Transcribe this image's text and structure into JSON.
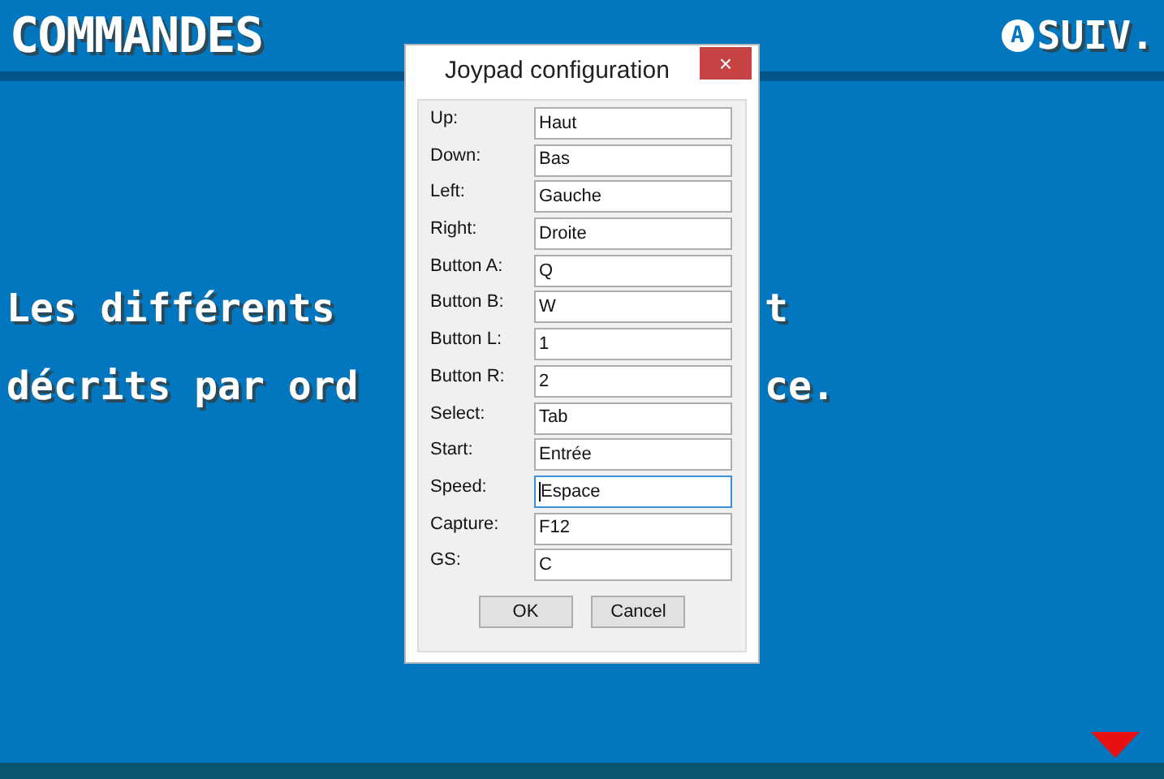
{
  "game_screen": {
    "header_title": "COMMANDES",
    "next_button": {
      "key": "A",
      "label": "SUIV."
    },
    "text_lines": [
      {
        "left": "Les différents",
        "right": "t"
      },
      {
        "left": "décrits par ord",
        "right": "ce."
      }
    ]
  },
  "dialog": {
    "title": "Joypad configuration",
    "close": "×",
    "fields": [
      {
        "label": "Up:",
        "value": "Haut",
        "focused": false
      },
      {
        "label": "Down:",
        "value": "Bas",
        "focused": false
      },
      {
        "label": "Left:",
        "value": "Gauche",
        "focused": false
      },
      {
        "label": "Right:",
        "value": "Droite",
        "focused": false
      },
      {
        "label": "Button A:",
        "value": "Q",
        "focused": false
      },
      {
        "label": "Button B:",
        "value": "W",
        "focused": false
      },
      {
        "label": "Button L:",
        "value": "1",
        "focused": false
      },
      {
        "label": "Button R:",
        "value": "2",
        "focused": false
      },
      {
        "label": "Select:",
        "value": "Tab",
        "focused": false
      },
      {
        "label": "Start:",
        "value": "Entrée",
        "focused": false
      },
      {
        "label": "Speed:",
        "value": "Espace",
        "focused": true
      },
      {
        "label": "Capture:",
        "value": "F12",
        "focused": false
      },
      {
        "label": "GS:",
        "value": "C",
        "focused": false
      }
    ],
    "buttons": [
      "OK",
      "Cancel"
    ]
  }
}
